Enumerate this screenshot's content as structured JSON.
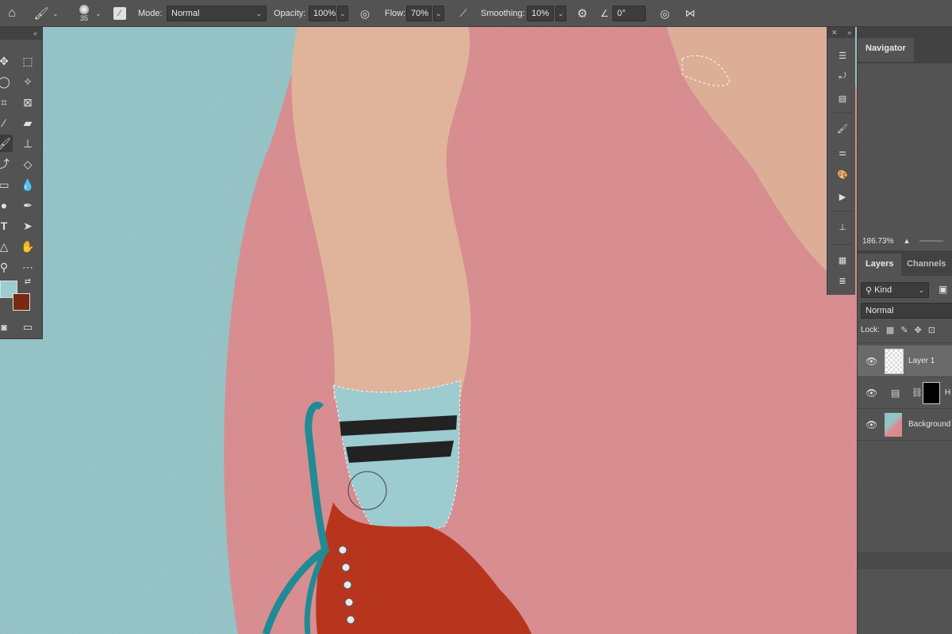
{
  "options": {
    "brush_size": "35",
    "mode_label": "Mode:",
    "mode_value": "Normal",
    "opacity_label": "Opacity:",
    "opacity_value": "100%",
    "flow_label": "Flow:",
    "flow_value": "70%",
    "smoothing_label": "Smoothing:",
    "smoothing_value": "10%",
    "angle_value": "0°"
  },
  "toolbar": {
    "collapse": "«",
    "tools": [
      "move-tool",
      "marquee-tool",
      "lasso-tool",
      "magic-wand-tool",
      "crop-tool",
      "frame-tool",
      "eyedropper-tool",
      "healing-brush-tool",
      "brush-tool",
      "clone-stamp-tool",
      "history-brush-tool",
      "eraser-tool",
      "gradient-tool",
      "blur-tool",
      "dodge-tool",
      "pen-tool",
      "type-tool",
      "path-selection-tool",
      "shape-tool",
      "hand-tool",
      "zoom-tool",
      "more-tools"
    ],
    "foreground_color": "#9ccbd0",
    "background_color": "#7a2a12"
  },
  "navigator": {
    "tab_label": "Navigator",
    "zoom": "186.73%"
  },
  "layers_panel": {
    "tab_layers": "Layers",
    "tab_channels": "Channels",
    "filter_kind": "Kind",
    "blend_mode": "Normal",
    "lock_label": "Lock:",
    "layers": [
      {
        "name": "Layer 1"
      },
      {
        "name": "H"
      },
      {
        "name": "Background"
      }
    ]
  },
  "colors": {
    "panel_bg": "#535353",
    "wall_blue": "#93c3c6",
    "wall_pink": "#d98b8e",
    "skin": "#e0b49b",
    "sock": "#9ccbd0",
    "boot": "#b8351d",
    "lace": "#1f8b95"
  }
}
